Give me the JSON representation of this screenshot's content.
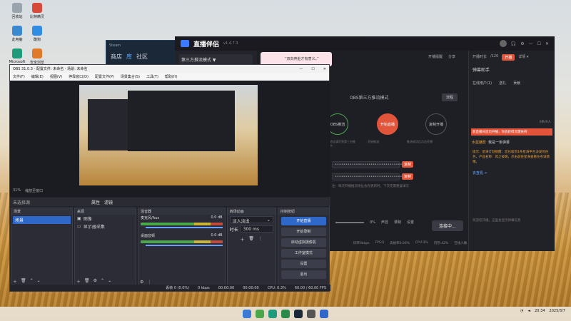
{
  "desktop": {
    "icons": [
      {
        "label": "回收站",
        "color": "#9aa4ad"
      },
      {
        "label": "比特精灵",
        "color": "#d74a3a"
      },
      {
        "label": "此电脑",
        "color": "#3a88d0"
      },
      {
        "label": "酷狗",
        "color": "#2f8de4"
      },
      {
        "label": "Microsoft Edge",
        "color": "#1f9a7a"
      },
      {
        "label": "安全浏览",
        "color": "#e07a2a"
      }
    ]
  },
  "steam": {
    "title": "Steam",
    "nav": [
      "商店",
      "库",
      "社区"
    ]
  },
  "live": {
    "app_name": "直播伴侣",
    "version": "v1.4.7.3",
    "mode": "第三方推流模式 ▼",
    "banner": "“双向奔赴才有意义。”",
    "header_right": [
      "开播时长",
      "/120",
      "开播",
      "详情 ▾"
    ],
    "top_actions": [
      "开播提醒",
      "分享"
    ],
    "left_counts": [
      "0",
      "0"
    ],
    "section": "OBS第三方推流模式",
    "guide_btn": "流程",
    "right_top": "进出",
    "steps": [
      {
        "label": "OBS推流",
        "badge": "1"
      },
      {
        "label": "开始直播",
        "badge": "2"
      },
      {
        "label": "复制开播",
        "badge": "3"
      }
    ],
    "step_hint": [
      "将推流地址填写到第三方推流软件中",
      "开始推流",
      "推流成功后点击开播"
    ],
    "field1": "••••••••••••••••••••••••••••••••",
    "field2": "••••••••••••••••••••••••••••••••",
    "copy_label": "复制",
    "note": "注：每次开播推流地址会有更新时，下次无需重复填写",
    "footer": [
      "声音",
      "录制",
      "设置"
    ],
    "vol": "0%",
    "connect": "连接中...",
    "stats": [
      "码率0kbps",
      "FPS:0",
      "丢帧率0.00%",
      "CPU:3%",
      "内存:42%",
      "在线人数"
    ],
    "right": {
      "title": "弹幕助手",
      "tabs": [
        "在线用户(1)",
        "送礼",
        "贡献"
      ],
      "count_label": "0条/0人",
      "welcome": "新直播间首页开播，你会获得流量扶持",
      "user": "水蓝魅影",
      "user_msg": "我是一条弹幕",
      "notice": "提示：星海计划提醒：您已收到1条星海平台派发的任务，产品名称：风之彼端，点击前往星海查看任务详情哦。",
      "link": "去查看 >",
      "tip": "欢迎您开播，这里会显示弹幕信息"
    }
  },
  "obs": {
    "title": "OBS 31.0.3 - 配置文件: 未命名 - 场景: 未命名",
    "menu": [
      "文件(F)",
      "编辑(E)",
      "视图(V)",
      "停靠窗口(D)",
      "配置文件(P)",
      "场景集合(S)",
      "工具(T)",
      "帮助(H)"
    ],
    "zoom": "31%",
    "zoom_sel": "缩放至窗口",
    "panelbar": [
      "未选择源",
      "属性",
      "滤镜"
    ],
    "docks": {
      "scenes": {
        "title": "场景",
        "items": [
          "场景"
        ]
      },
      "sources": {
        "title": "来源",
        "items": [
          {
            "name": "图像"
          },
          {
            "name": "显示器采集"
          }
        ]
      },
      "mixer": {
        "title": "混音器",
        "ch": [
          {
            "name": "麦克风/Aux",
            "db": "0.0 dB"
          },
          {
            "name": "桌面音频",
            "db": "0.0 dB"
          }
        ]
      },
      "transitions": {
        "title": "转场动画",
        "type": "淡入淡出",
        "duration_label": "时长",
        "duration": "300 ms"
      },
      "controls": {
        "title": "控制按钮",
        "buttons": [
          "开始直播",
          "开始录制",
          "启动虚拟摄像机",
          "工作室模式",
          "设置",
          "退出"
        ]
      }
    },
    "status": [
      "丢帧 0 (0.0%)",
      "0 kbps",
      "00:00:00",
      "00:00:00",
      "CPU: 0.3%",
      "60.00 / 60.00 FPS"
    ]
  },
  "taskbar": {
    "time": "20:34",
    "date": "2025/3/7"
  }
}
